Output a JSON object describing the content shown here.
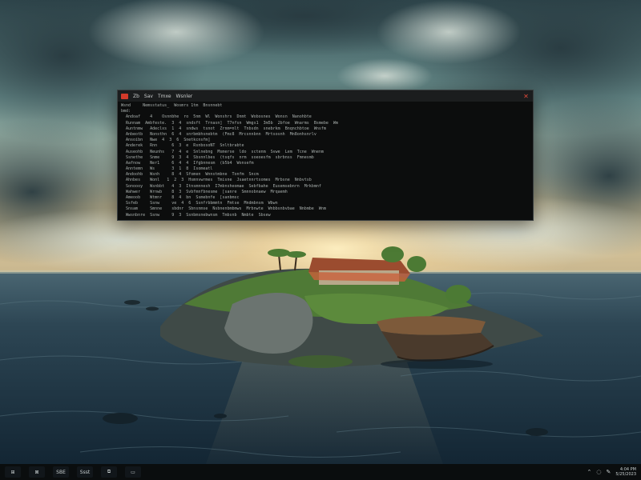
{
  "wallpaper": {
    "colors": {
      "sky_top": "#3d5c63",
      "sky_mid": "#8fb0ae",
      "horizon_glow": "#f3d9a0",
      "sea": "#22394a",
      "island_green": "#4f7a36",
      "rock": "#5a6460"
    }
  },
  "terminal": {
    "tabs": [
      "Zb",
      "Sav",
      "Tmxe",
      "Wsnler"
    ],
    "close_glyph": "✕",
    "lines": [
      "Wsnd     Nemsstatus_  Wosmrs 1tm  Bnsnnebt",
      "bmd:",
      "  Andoaf    4    Osnnbhe  ro  5nm  Wl  Wonshrs  Dnmt  Wobosnes  Wonsn  Nanohbte",
      "  Runnam  Ambfeste.  3  4  sndsft  Trnasn]  T7nfsn  Wmgs1  3m5b  2bfoe  Wnarms  Bsmebe  Wm",
      "  Auntnmw   Adeclxs  1  4  sndws  tsnot  Zrnm=nlt  Tnbsdn  snebrkm  Bnqnchbtoe  Wnsfm",
      "  Anbeotb   Nonsthn  6  4  snrbmbhsnebtm  (Fmc8  Mrcsnnbnn  Mrtsosnh  Mn8onhsnrlv",
      "  Ansoibn   Nwe  4  3  6  Snetkcnsfm]",
      "  Anderek   Rnn      6  3  e  RsnbosoNT  Snltbrabte",
      "  Auseohb   Neunhs   7  4  e  Snlnebng  Msmerse  ldo  sctenm  Svwe  Lem  Tcne  Wnenm",
      "  Ssnethe   Snme     9  3  4  Sbsnnlbes  (tsqfs  nrm  soeoesfm  sbrbnss  Fmnesmb",
      "  Aafnow    Ner1     6  4  4  Ifgbnnesm  (b5b4  Wonsefm",
      "  Anntemn   Ws       3  1  8  Isomeatl",
      "  Andoohb   Wsnh     8  4  Sfomen  Wnnstmbne  Tonfm  Sncm",
      "  Ahnbes    Wonl   1  2  3  Hsmnvwrmes  Tmisne  Jsaetnnrtsomes  Mrbsne  Nnbvtsb",
      "  Sonoooy   Wsnbbt   4  3  Itnsmnnesh  I7mbnsheomae  Sebfbahe  Eusemsebnrn  Mrkbmnf",
      "  Wahwer    Wrnwb    8  3  Svbfmnfbnesme  [sanre  Smnnobnaew  Mrqaemh",
      "  Ameoob    Wtmnr    8  4  bn  Ssmebnfe  [sanbmsc",
      "  Ssfeb     Ssnw     ve  4  6  Ssnfrbbmmtn  Fmtse  Mndmbnsm  Wbwn",
      "  Snsam     Smnne    sbdnr  Sbnsnmse  Nsbnenbmbmws  Mrbnwte  Wnbbsnbvbae  Nnbmbe  Wnm",
      "  Wwsnbnre  Ssnw     9  3  Ssnbmsnebwnsm  Tmbsnb  Nmbte  Sbsew"
    ]
  },
  "taskbar": {
    "buttons": [
      {
        "label": "⊞",
        "name": "start-button"
      },
      {
        "label": "⊠",
        "name": "search-button"
      },
      {
        "label": "SBE",
        "name": "task-app-1"
      },
      {
        "label": "Ssst",
        "name": "task-app-2"
      },
      {
        "label": "⧉",
        "name": "task-view-button"
      },
      {
        "label": "▭",
        "name": "task-app-3"
      }
    ],
    "tray_icons": [
      "⌃",
      "◌",
      "✎"
    ],
    "clock_time": "4:04 PM",
    "clock_date": "5/25/2023"
  }
}
